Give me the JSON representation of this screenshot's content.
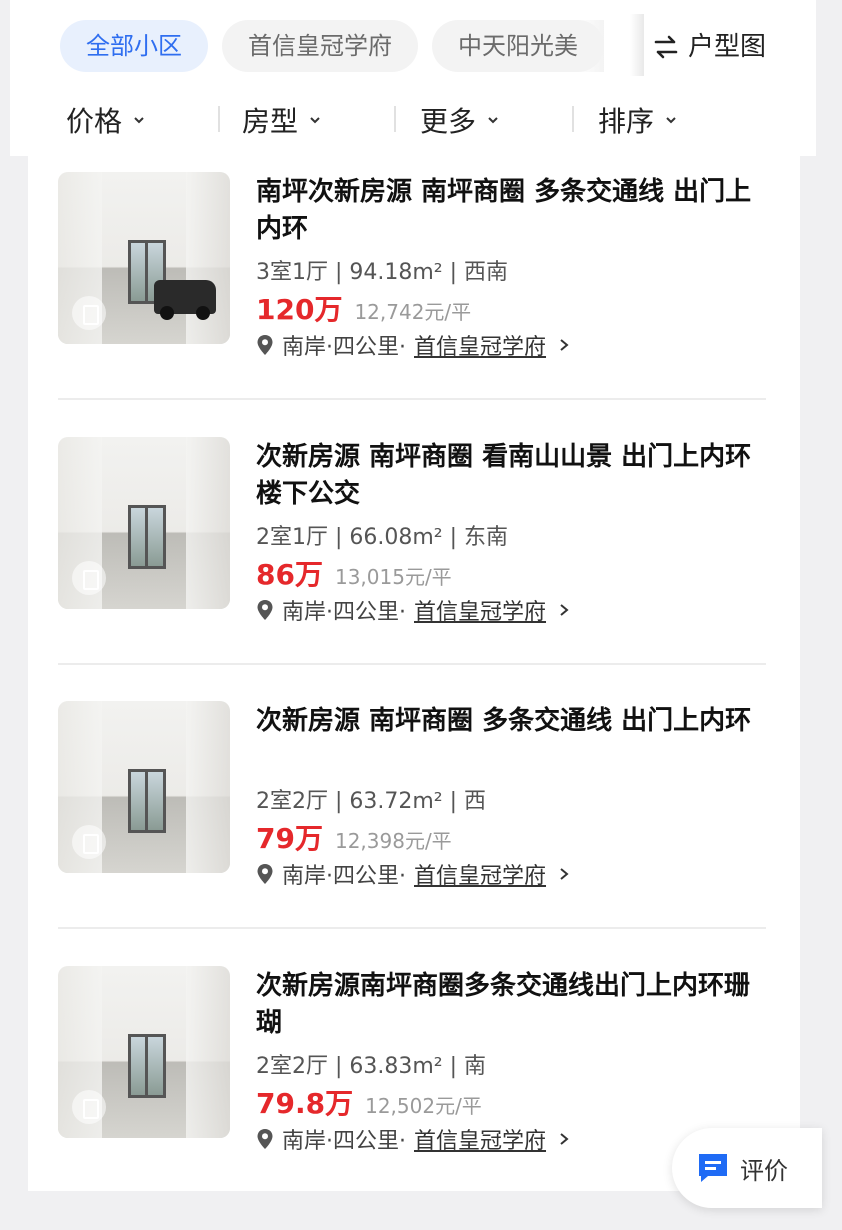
{
  "header": {
    "chips": [
      "全部小区",
      "首信皇冠学府",
      "中天阳光美"
    ],
    "layout_button": "户型图",
    "filters": [
      "价格",
      "房型",
      "更多",
      "排序"
    ]
  },
  "colors": {
    "accent_blue": "#2f6ef0",
    "price_red": "#e5282b",
    "review_icon": "#1f6bf5"
  },
  "listings": [
    {
      "title": "南坪次新房源 南坪商圈 多条交通线 出门上内环",
      "specs": "3室1厅 | 94.18m² | 西南",
      "price": "120万",
      "unit_price": "12,742元/平",
      "area": "南岸·四公里·",
      "community": "首信皇冠学府"
    },
    {
      "title": "次新房源 南坪商圈 看南山山景 出门上内环 楼下公交",
      "specs": "2室1厅 | 66.08m² | 东南",
      "price": "86万",
      "unit_price": "13,015元/平",
      "area": "南岸·四公里·",
      "community": "首信皇冠学府"
    },
    {
      "title": "次新房源 南坪商圈 多条交通线 出门上内环",
      "specs": "2室2厅 | 63.72m² | 西",
      "price": "79万",
      "unit_price": "12,398元/平",
      "area": "南岸·四公里·",
      "community": "首信皇冠学府"
    },
    {
      "title": "次新房源南坪商圈多条交通线出门上内环珊瑚",
      "specs": "2室2厅 | 63.83m² | 南",
      "price": "79.8万",
      "unit_price": "12,502元/平",
      "area": "南岸·四公里·",
      "community": "首信皇冠学府"
    }
  ],
  "review_button": {
    "label": "评价"
  }
}
